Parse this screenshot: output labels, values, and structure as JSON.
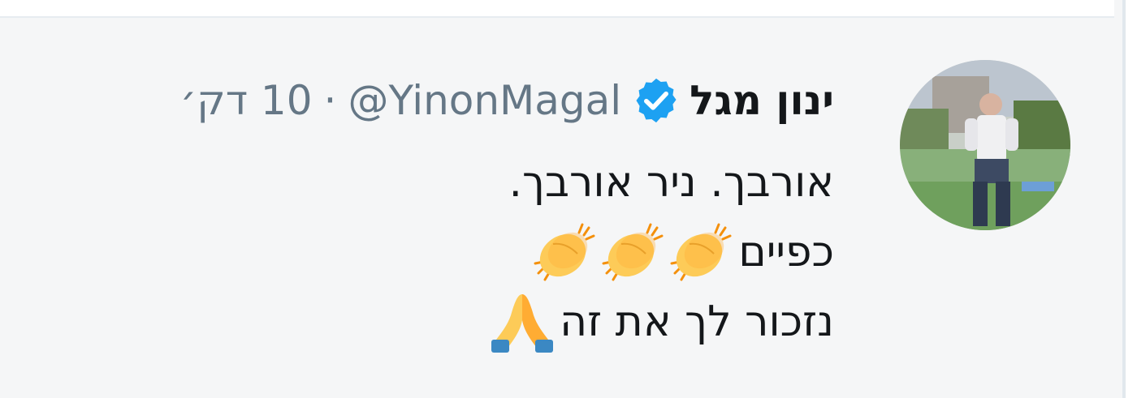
{
  "tweet": {
    "display_name": "ינון מגל",
    "handle": "@YinonMagal",
    "separator": "·",
    "time": "10 דק׳",
    "lines": [
      "אורבך. ניר אורבך.",
      "כפיים",
      "נזכור לך את זה"
    ],
    "emojis": {
      "line2": [
        "clapping-hands-icon",
        "clapping-hands-icon",
        "clapping-hands-icon"
      ],
      "line3": [
        "folded-hands-icon"
      ]
    }
  },
  "colors": {
    "name": "#14171a",
    "muted": "#657786",
    "verified": "#1da1f2",
    "background": "#f5f6f7"
  }
}
